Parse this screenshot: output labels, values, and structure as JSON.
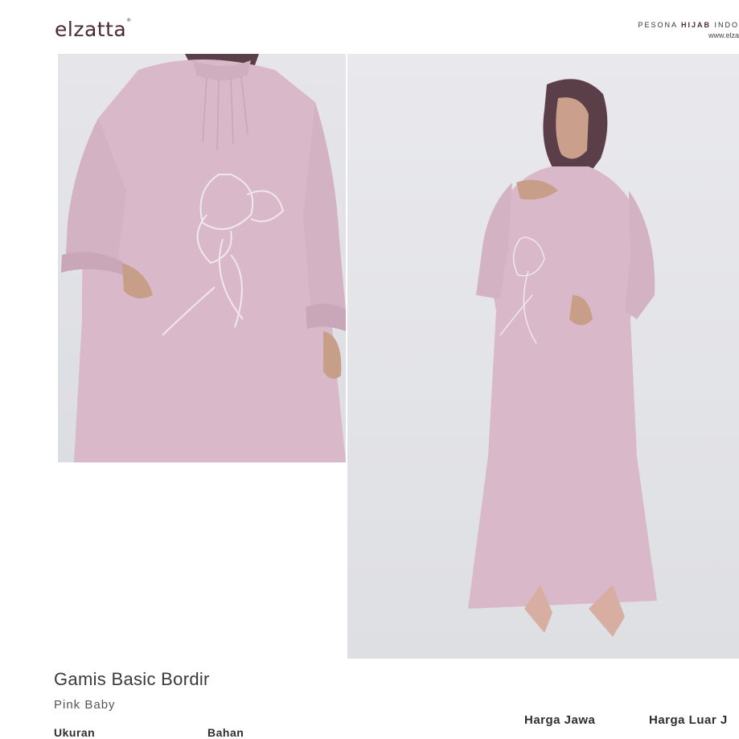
{
  "brand": {
    "logo_text": "elzatta",
    "trademark": "®"
  },
  "tagline": {
    "prefix": "PESONA ",
    "bold": "HIJAB",
    "suffix": " INDO"
  },
  "website": "www.elza",
  "product": {
    "name": "Gamis Basic Bordir",
    "color": "Pink Baby"
  },
  "specs": {
    "size_label": "Ukuran",
    "material_label": "Bahan"
  },
  "prices": {
    "java_label": "Harga Jawa",
    "outside_java_label": "Harga Luar J"
  },
  "colors": {
    "dress": "#d9b9c9",
    "hijab": "#5b3f48",
    "brand": "#4a2b34"
  }
}
